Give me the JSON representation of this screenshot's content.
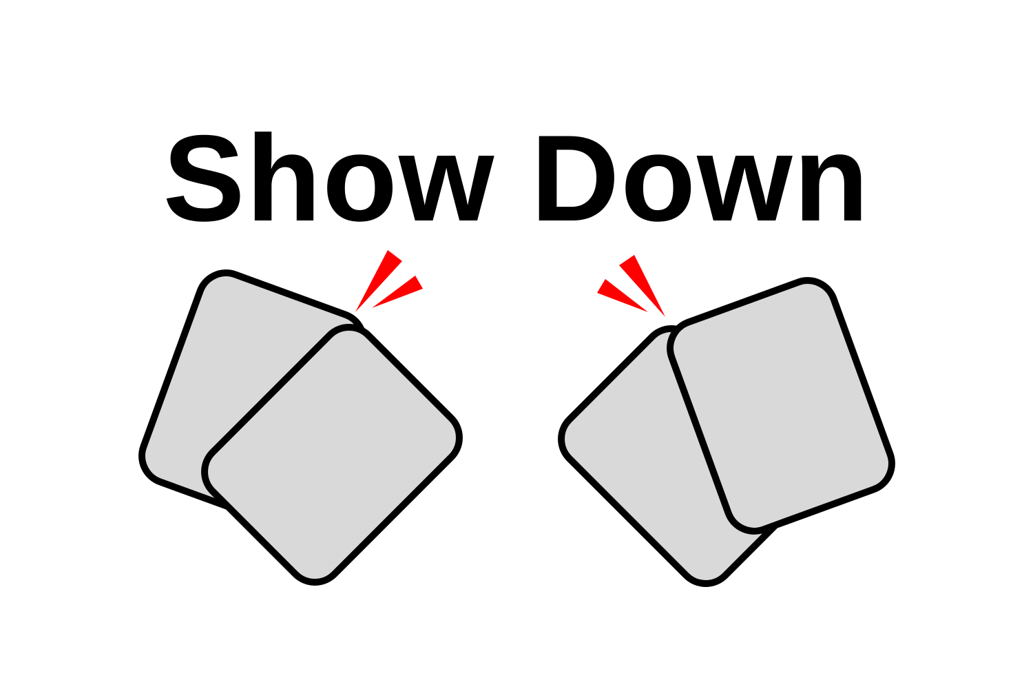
{
  "title": "Show Down",
  "colors": {
    "background": "#ffffff",
    "card_fill": "#d9d9d9",
    "card_stroke": "#000000",
    "burst": "#ff0000",
    "text": "#000000"
  },
  "icons": [
    "playing-card-icon",
    "impact-burst-icon"
  ]
}
